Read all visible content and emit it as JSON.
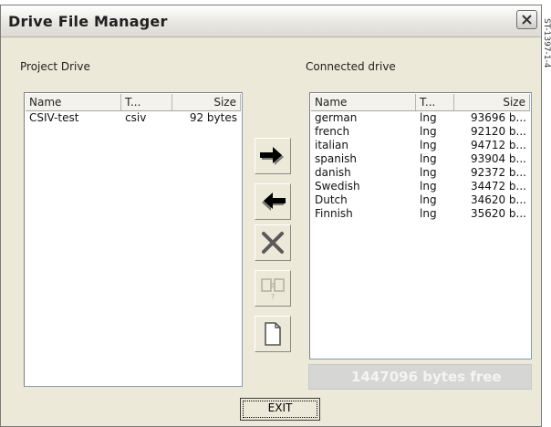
{
  "window": {
    "title": "Drive File Manager"
  },
  "project": {
    "label": "Project Drive",
    "columns": [
      "Name",
      "T...",
      "Size"
    ],
    "rows": [
      {
        "name": "CSIV-test",
        "type": "csiv",
        "size": "92 bytes"
      }
    ]
  },
  "connected": {
    "label": "Connected drive",
    "columns": [
      "Name",
      "T...",
      "Size"
    ],
    "rows": [
      {
        "name": "german",
        "type": "lng",
        "size": "93696 b..."
      },
      {
        "name": "french",
        "type": "lng",
        "size": "92120 b..."
      },
      {
        "name": "italian",
        "type": "lng",
        "size": "94712 b..."
      },
      {
        "name": "spanish",
        "type": "lng",
        "size": "93904 b..."
      },
      {
        "name": "danish",
        "type": "lng",
        "size": "92372 b..."
      },
      {
        "name": "Swedish",
        "type": "lng",
        "size": "34472 b..."
      },
      {
        "name": "Dutch",
        "type": "lng",
        "size": "34620 b..."
      },
      {
        "name": "Finnish",
        "type": "lng",
        "size": "35620 b..."
      }
    ]
  },
  "toolbar": {
    "copy_to_drive": "arrow-right-icon",
    "copy_to_project": "arrow-left-icon",
    "delete": "delete-x-icon",
    "compare": "compare-files-icon",
    "new_file": "new-file-icon"
  },
  "status": {
    "free_space": "1447096 bytes free"
  },
  "buttons": {
    "exit": "EXIT"
  },
  "side_caption": "ST-1397-1-4"
}
